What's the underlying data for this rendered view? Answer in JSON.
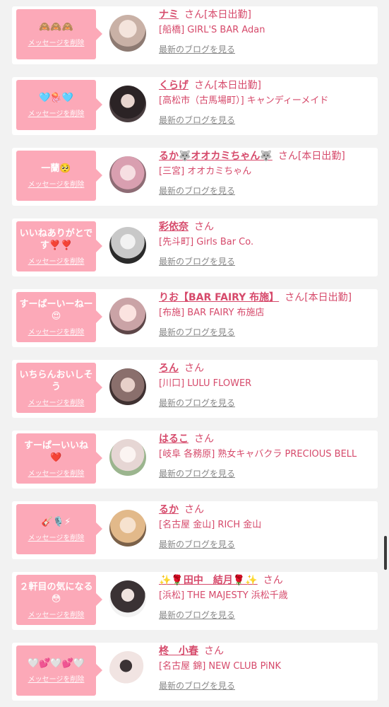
{
  "ui": {
    "delete_label": "メッセージを削除",
    "blog_label": "最新のブログを見る",
    "san_label": "さん"
  },
  "messages": [
    {
      "text": "🙈🙈🙈",
      "name": "ナミ",
      "status": "[本日出勤]",
      "shop": "[船橋] GIRL'S BAR Adan",
      "avatar_color": "#d9c9bf"
    },
    {
      "text": "🩵🪼🩵",
      "name": "くらげ",
      "status": "[本日出勤]",
      "shop": "[高松市（古馬場町）] キャンディーメイド",
      "avatar_color": "#3b3233"
    },
    {
      "text": "一蘭🥺",
      "name": "るか🐺オオカミちゃん🐺",
      "status": "[本日出勤]",
      "shop": "[三宮] オオカミちゃん",
      "avatar_color": "#e6b7c0"
    },
    {
      "text": "いいねありがとです❣️❣️",
      "name": "彩依奈",
      "status": "",
      "shop": "[先斗町] Girls Bar Co.",
      "avatar_color": "#dcdcdc"
    },
    {
      "text": "すーぱーいーねー😍",
      "name": "りお【BAR FAIRY 布施】",
      "status": "[本日出勤]",
      "shop": "[布施] BAR FAIRY 布施店",
      "avatar_color": "#e8c7c9"
    },
    {
      "text": "いちらんおいしそう",
      "name": "ろん",
      "status": "",
      "shop": "[川口] LULU FLOWER",
      "avatar_color": "#9a8a88"
    },
    {
      "text": "すーぱーいいね❤️",
      "name": "はるこ",
      "status": "",
      "shop": "[岐阜 各務原]  熟女キャバクラ PRECIOUS BELL",
      "avatar_color": "#efe6e6"
    },
    {
      "text": "🎸🎙️⚡",
      "name": "るか",
      "status": "",
      "shop": "[名古屋 金山] RICH 金山",
      "avatar_color": "#e3c49a"
    },
    {
      "text": "２軒目の気になる😳",
      "name": "✨🌹田中　結月🌹✨",
      "status": "",
      "shop": "[浜松] THE MAJESTY 浜松千歳",
      "avatar_color": "#2e2a2c"
    },
    {
      "text": "🤍💕🤍💕🤍",
      "name": "柊　小春",
      "status": "",
      "shop": "[名古屋 錦] NEW CLUB PiNK",
      "avatar_color": "#efe9ea"
    }
  ]
}
